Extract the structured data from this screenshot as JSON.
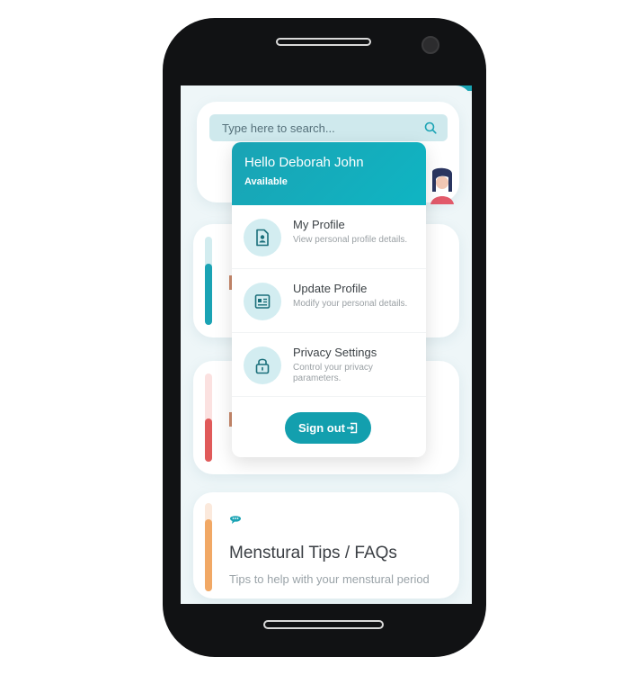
{
  "search": {
    "placeholder": "Type here to search..."
  },
  "dropdown": {
    "greeting": "Hello Deborah John",
    "status": "Available",
    "items": [
      {
        "label": "My Profile",
        "description": "View personal profile details.",
        "icon": "profile-doc-icon"
      },
      {
        "label": "Update Profile",
        "description": "Modify your personal details.",
        "icon": "id-card-icon"
      },
      {
        "label": "Privacy Settings",
        "description": "Control your privacy parameters.",
        "icon": "lock-icon"
      }
    ],
    "signout_label": "Sign out"
  },
  "cards": {
    "tips": {
      "title": "Menstural Tips / FAQs",
      "subtitle": "Tips to help with your menstural period",
      "icon": "chat-bubble-icon"
    }
  },
  "colors": {
    "accent": "#139fae",
    "teal_bar": "#1aa3b4",
    "red_bar": "#e05a5a",
    "orange_bar": "#f1a865"
  }
}
